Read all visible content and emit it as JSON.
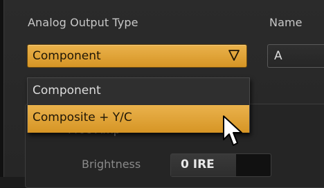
{
  "labels": {
    "analog_output_type": "Analog Output Type",
    "name": "Name",
    "proc_amp": "Proc Amp",
    "brightness": "Brightness"
  },
  "combo": {
    "selected": "Component",
    "options": [
      "Component",
      "Composite + Y/C"
    ],
    "highlighted_index": 1
  },
  "name_field": {
    "value": "A"
  },
  "brightness_field": {
    "value": "0 IRE"
  },
  "colors": {
    "accent": "#e2a536",
    "panel": "#2b2b2b",
    "text": "#c8c8c8"
  },
  "icons": {
    "dropdown_arrow": "triangle-down-outline",
    "cursor": "arrow-pointer"
  }
}
